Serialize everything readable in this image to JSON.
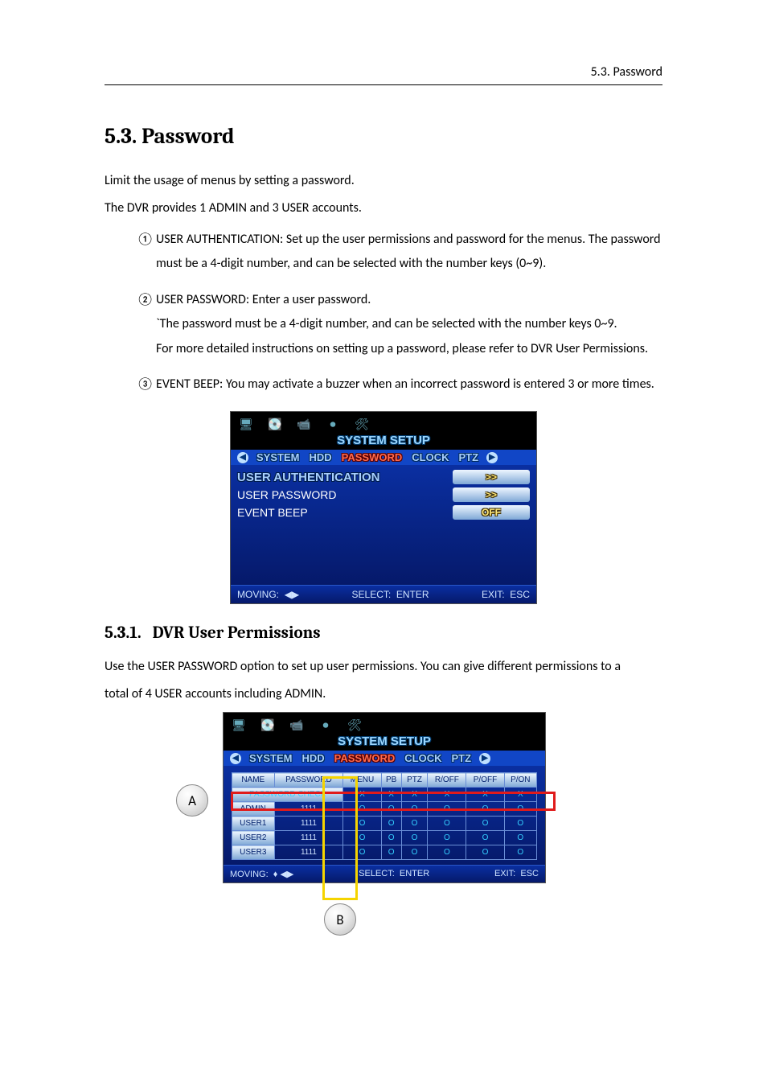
{
  "header": {
    "right": "5.3. Password"
  },
  "section": {
    "number": "5.3.",
    "title": "Password"
  },
  "intro": {
    "p1": "Limit the usage of menus by setting a password.",
    "p2": "The DVR provides 1 ADMIN and 3 USER accounts."
  },
  "list": {
    "i1": {
      "marker": "①",
      "text_a": "USER AUTHENTICATION: Set up the user permissions and password for the menus. The password",
      "text_b": "must be a 4-digit number, and can be selected with the number keys (0~9)."
    },
    "i2": {
      "marker": "②",
      "text_a": "USER PASSWORD: Enter a user password.",
      "text_b": "`The password must be a 4-digit number, and can be selected with the number keys 0~9.",
      "text_c": "For more detailed instructions on setting up a password, please refer to DVR User Permissions."
    },
    "i3": {
      "marker": "③",
      "text_a": "EVENT BEEP: You may activate a buzzer when an incorrect password is entered 3 or more times."
    }
  },
  "dvr1": {
    "banner": "SYSTEM SETUP",
    "tabs": {
      "t1": "SYSTEM",
      "t2": "HDD",
      "t3": "PASSWORD",
      "t4": "CLOCK",
      "t5": "PTZ"
    },
    "rows": {
      "r1": {
        "label": "USER AUTHENTICATION",
        "value": ">>"
      },
      "r2": {
        "label": "USER PASSWORD",
        "value": ">>"
      },
      "r3": {
        "label": "EVENT BEEP",
        "value": "OFF"
      }
    },
    "footer": {
      "moving_label": "MOVING:",
      "moving_val": "◀▶",
      "select_label": "SELECT:",
      "select_val": "ENTER",
      "exit_label": "EXIT:",
      "exit_val": "ESC"
    }
  },
  "subsection": {
    "number": "5.3.1.",
    "title": "DVR User Permissions"
  },
  "sub_intro": {
    "p1": "Use the USER PASSWORD option to set up user permissions. You can give different permissions to a",
    "p2": "total of 4 USER accounts including ADMIN."
  },
  "dvr2": {
    "banner": "SYSTEM SETUP",
    "tabs": {
      "t1": "SYSTEM",
      "t2": "HDD",
      "t3": "PASSWORD",
      "t4": "CLOCK",
      "t5": "PTZ"
    },
    "headers": {
      "h1": "NAME",
      "h2": "PASSWORD",
      "h3": "MENU",
      "h4": "PB",
      "h5": "PTZ",
      "h6": "R/OFF",
      "h7": "P/OFF",
      "h8": "P/ON"
    },
    "checkrow": {
      "label": "PASSWORD CHECK",
      "v1": "X",
      "v2": "X",
      "v3": "X",
      "v4": "X",
      "v5": "X",
      "v6": "X"
    },
    "rows": {
      "r1": {
        "name": "ADMIN",
        "pw": "1111",
        "c1": "O",
        "c2": "O",
        "c3": "O",
        "c4": "O",
        "c5": "O",
        "c6": "O"
      },
      "r2": {
        "name": "USER1",
        "pw": "1111",
        "c1": "O",
        "c2": "O",
        "c3": "O",
        "c4": "O",
        "c5": "O",
        "c6": "O"
      },
      "r3": {
        "name": "USER2",
        "pw": "1111",
        "c1": "O",
        "c2": "O",
        "c3": "O",
        "c4": "O",
        "c5": "O",
        "c6": "O"
      },
      "r4": {
        "name": "USER3",
        "pw": "1111",
        "c1": "O",
        "c2": "O",
        "c3": "O",
        "c4": "O",
        "c5": "O",
        "c6": "O"
      }
    },
    "footer": {
      "moving_label": "MOVING:",
      "moving_val": "♦ ◀▶",
      "select_label": "SELECT:",
      "select_val": "ENTER",
      "exit_label": "EXIT:",
      "exit_val": "ESC"
    }
  },
  "callouts": {
    "A": "A",
    "B": "B"
  }
}
